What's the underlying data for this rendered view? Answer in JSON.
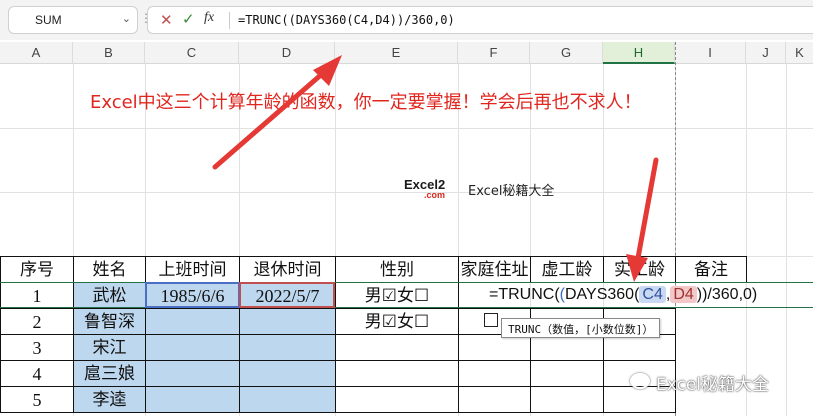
{
  "formula_bar": {
    "name_box": "SUM",
    "formula": "=TRUNC((DAYS360(C4,D4))/360,0)",
    "fx_label": "fx"
  },
  "columns": [
    "A",
    "B",
    "C",
    "D",
    "E",
    "F",
    "G",
    "H",
    "I",
    "J",
    "K"
  ],
  "selected_column": "H",
  "headline": "Excel中这三个计算年龄的函数，你一定要掌握！学会后再也不求人！",
  "logo": {
    "line1_a": "Excel",
    "line1_b": "2",
    "line2": ".com"
  },
  "brand": "Excel秘籍大全",
  "table": {
    "headers": [
      "序号",
      "姓名",
      "上班时间",
      "退休时间",
      "性别",
      "家庭住址",
      "虚工龄",
      "实工龄",
      "备注"
    ],
    "rows": [
      {
        "no": "1",
        "name": "武松",
        "start": "1985/6/6",
        "retire": "2022/5/7",
        "gender": "男☑女☐"
      },
      {
        "no": "2",
        "name": "鲁智深",
        "start": "",
        "retire": "",
        "gender": "男☑女☐"
      },
      {
        "no": "3",
        "name": "宋江",
        "start": "",
        "retire": "",
        "gender": ""
      },
      {
        "no": "4",
        "name": "扈三娘",
        "start": "",
        "retire": "",
        "gender": ""
      },
      {
        "no": "5",
        "name": "李逵",
        "start": "",
        "retire": "",
        "gender": ""
      }
    ]
  },
  "cell_edit": {
    "prefix": "=TRUNC(",
    "open": "(",
    "fn": "DAYS360(",
    "arg1": "C4",
    "comma": ",",
    "arg2": "D4",
    "suffix": "))/360,0)"
  },
  "tooltip": "TRUNC（数值，[小数位数]）",
  "watermark": "Excel秘籍大全",
  "colors": {
    "accent": "#217346",
    "headline": "#e0261e",
    "arrow": "#e53935",
    "blue_fill": "#bdd7ee"
  }
}
